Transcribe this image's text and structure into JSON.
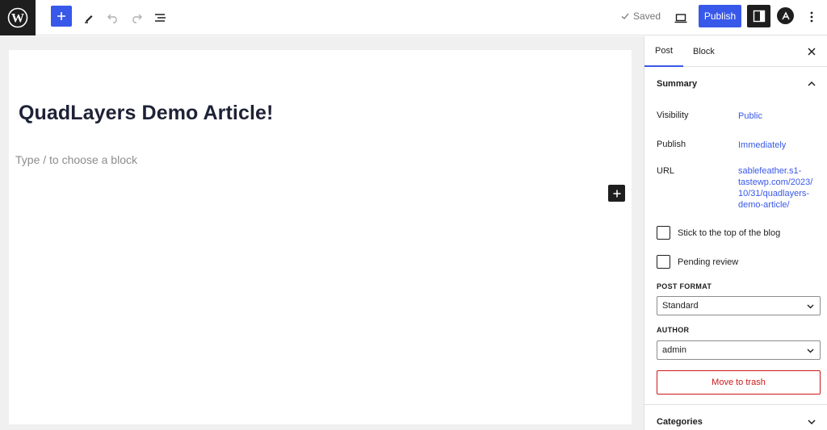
{
  "toolbar": {
    "saved_label": "Saved",
    "publish_label": "Publish",
    "icons": [
      "wordpress-logo-icon",
      "plus-icon",
      "pencil-icon",
      "undo-icon",
      "redo-icon",
      "list-view-icon",
      "check-icon",
      "desktop-preview-icon",
      "settings-icon",
      "astra-icon",
      "more-vertical-icon"
    ],
    "accent_color": "#3858e9"
  },
  "editor": {
    "title": "QuadLayers Demo Article!",
    "block_placeholder": "Type / to choose a block"
  },
  "sidebar": {
    "tabs": [
      "Post",
      "Block"
    ],
    "summary": {
      "title": "Summary",
      "visibility_label": "Visibility",
      "visibility_value": "Public",
      "publish_label": "Publish",
      "publish_value": "Immediately",
      "url_label": "URL",
      "url_lines": [
        "sablefeather.s1-",
        "tastewp.com/2023/",
        "10/31/quadlayers-",
        "demo-article/"
      ],
      "stick_label": "Stick to the top of the blog",
      "pending_label": "Pending review",
      "post_format_label": "POST FORMAT",
      "post_format_value": "Standard",
      "author_label": "AUTHOR",
      "author_value": "admin",
      "trash_label": "Move to trash"
    },
    "categories_title": "Categories",
    "danger_color": "#cc1818"
  }
}
